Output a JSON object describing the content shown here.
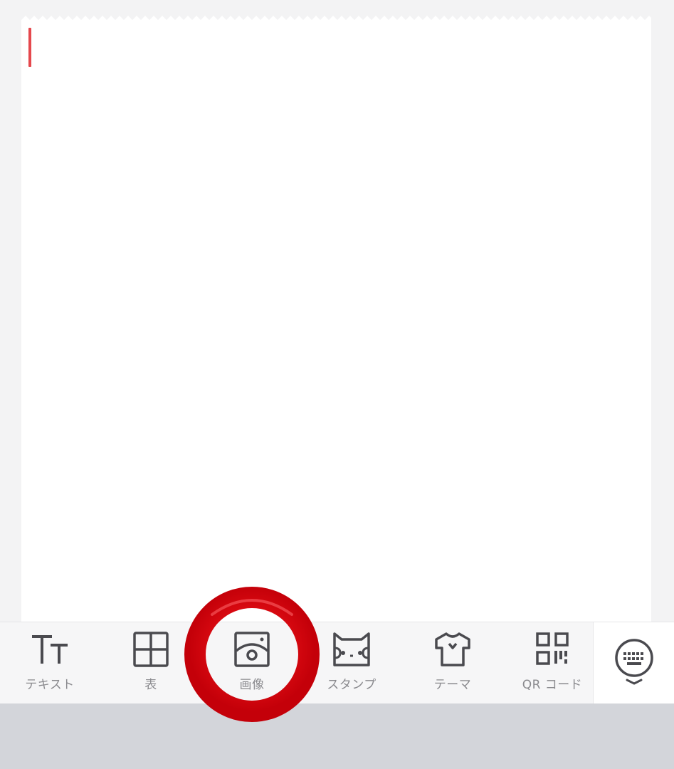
{
  "colors": {
    "background": "#f3f3f4",
    "paper": "#ffffff",
    "cursor": "#e5484d",
    "toolbar": "#f6f6f7",
    "icon": "#4a4a4f",
    "label": "#8a8a8e",
    "keyboard_area": "#d3d5da",
    "highlight": "#d9000b"
  },
  "editor": {
    "cursor_visible": true
  },
  "toolbar": {
    "items": [
      {
        "label": "テキスト",
        "icon": "text-size-icon"
      },
      {
        "label": "表",
        "icon": "table-grid-icon"
      },
      {
        "label": "画像",
        "icon": "image-icon"
      },
      {
        "label": "スタンプ",
        "icon": "sticker-icon"
      },
      {
        "label": "テーマ",
        "icon": "tshirt-icon"
      },
      {
        "label": "QR コード",
        "icon": "qr-code-icon"
      }
    ],
    "keyboard_toggle_icon": "keyboard-icon"
  },
  "annotation": {
    "highlighted_item": "画像"
  }
}
